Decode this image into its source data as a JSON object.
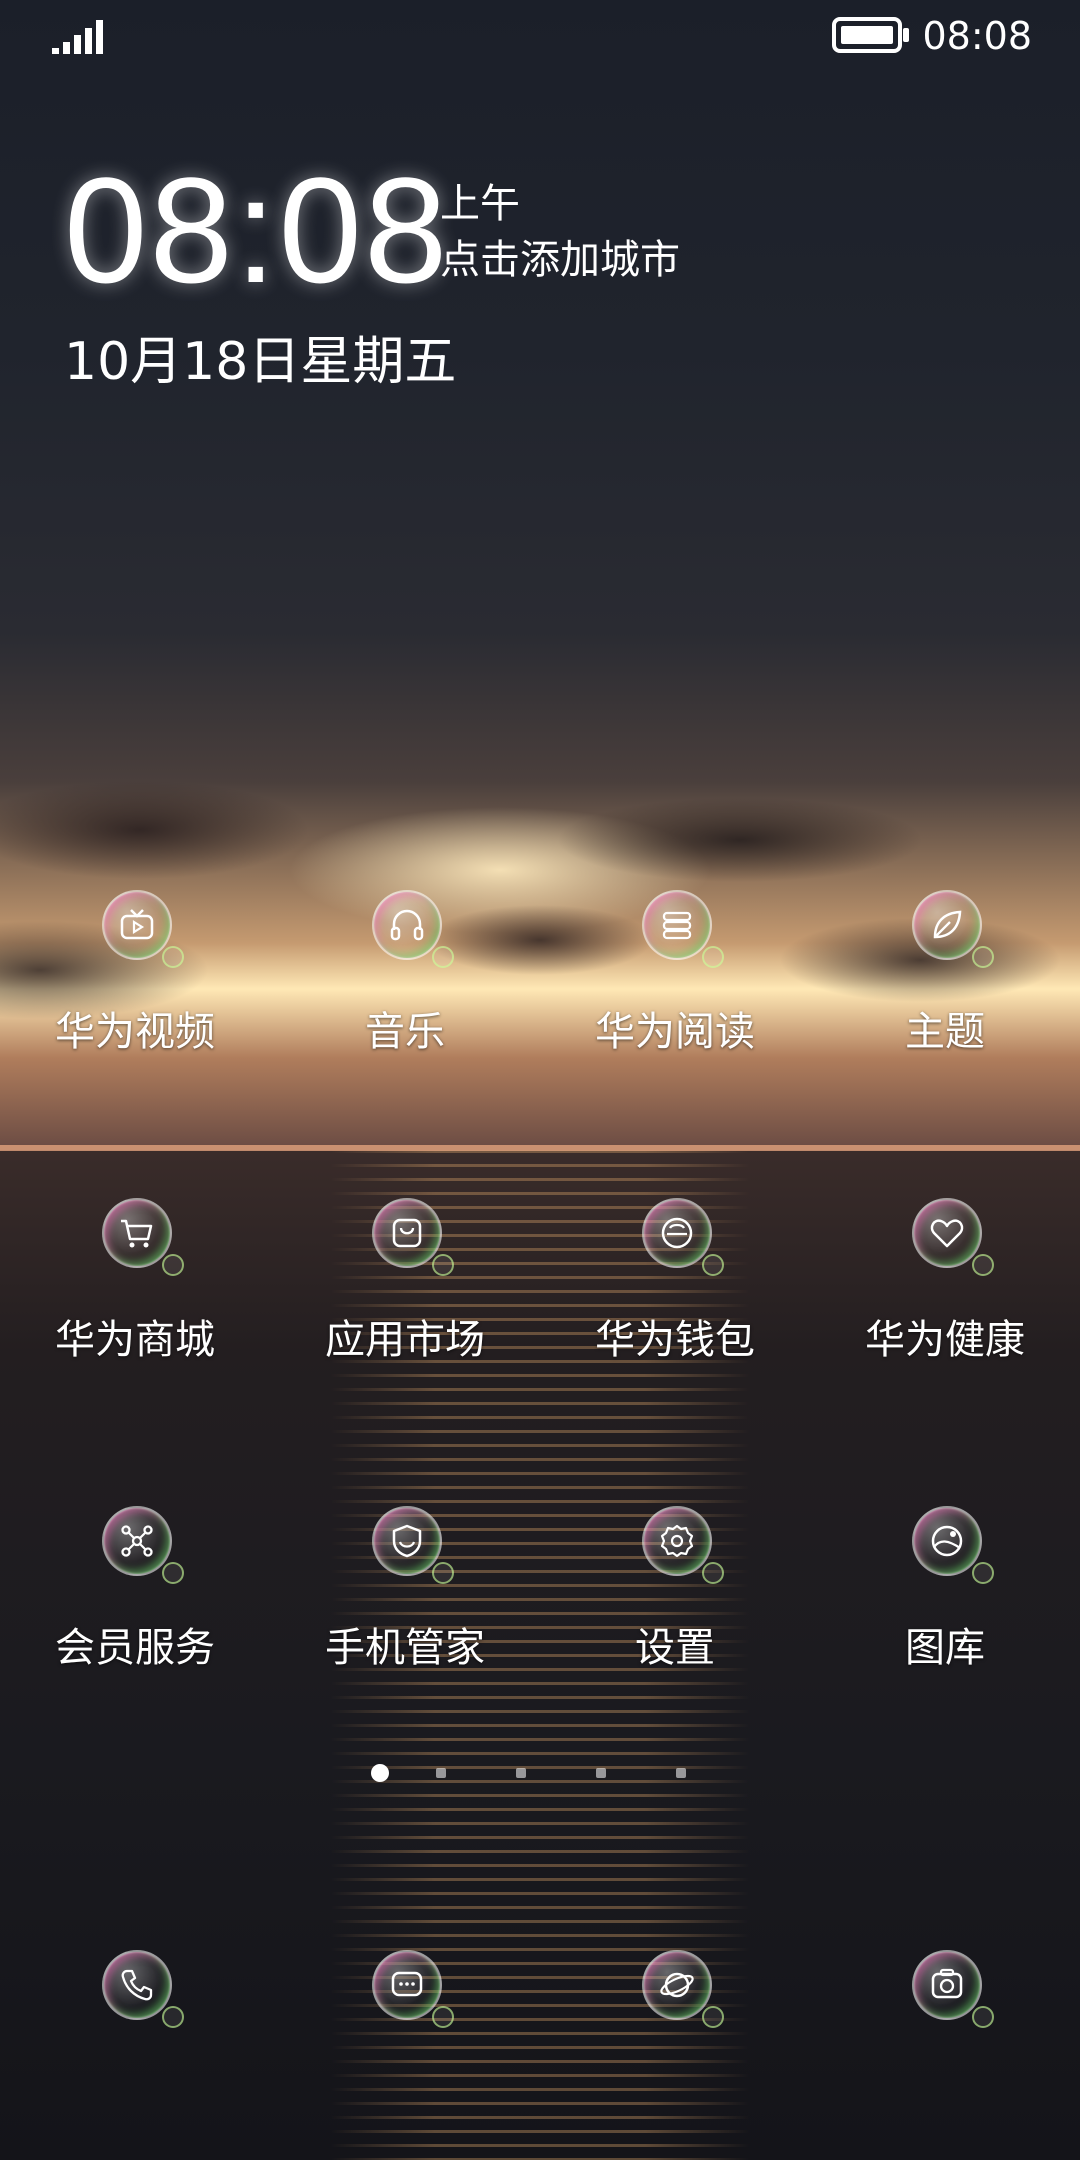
{
  "status_bar": {
    "time": "08:08",
    "signal_icon": "signal-bars-icon",
    "battery_icon": "battery-full-icon"
  },
  "clock_widget": {
    "time": "08:08",
    "ampm": "上午",
    "city_prompt": "点击添加城市",
    "date": "10月18日星期五"
  },
  "apps": [
    {
      "label": "华为视频",
      "icon": "video-tv-icon"
    },
    {
      "label": "音乐",
      "icon": "headphones-icon"
    },
    {
      "label": "华为阅读",
      "icon": "books-icon"
    },
    {
      "label": "主题",
      "icon": "leaf-icon"
    },
    {
      "label": "华为商城",
      "icon": "shopping-cart-icon"
    },
    {
      "label": "应用市场",
      "icon": "app-store-bag-icon"
    },
    {
      "label": "华为钱包",
      "icon": "wallet-icon"
    },
    {
      "label": "华为健康",
      "icon": "heart-icon"
    },
    {
      "label": "会员服务",
      "icon": "network-nodes-icon"
    },
    {
      "label": "手机管家",
      "icon": "shield-icon"
    },
    {
      "label": "设置",
      "icon": "gear-icon"
    },
    {
      "label": "图库",
      "icon": "gallery-icon"
    }
  ],
  "page_indicator": {
    "total": 5,
    "active": 1
  },
  "dock": [
    {
      "icon": "phone-icon"
    },
    {
      "icon": "messages-icon"
    },
    {
      "icon": "browser-planet-icon"
    },
    {
      "icon": "camera-icon"
    }
  ],
  "colors": {
    "text": "#ffffff",
    "sky_dark": "#1b1f29",
    "sunset": "#ffe8b5",
    "sea_dark": "#141419"
  }
}
